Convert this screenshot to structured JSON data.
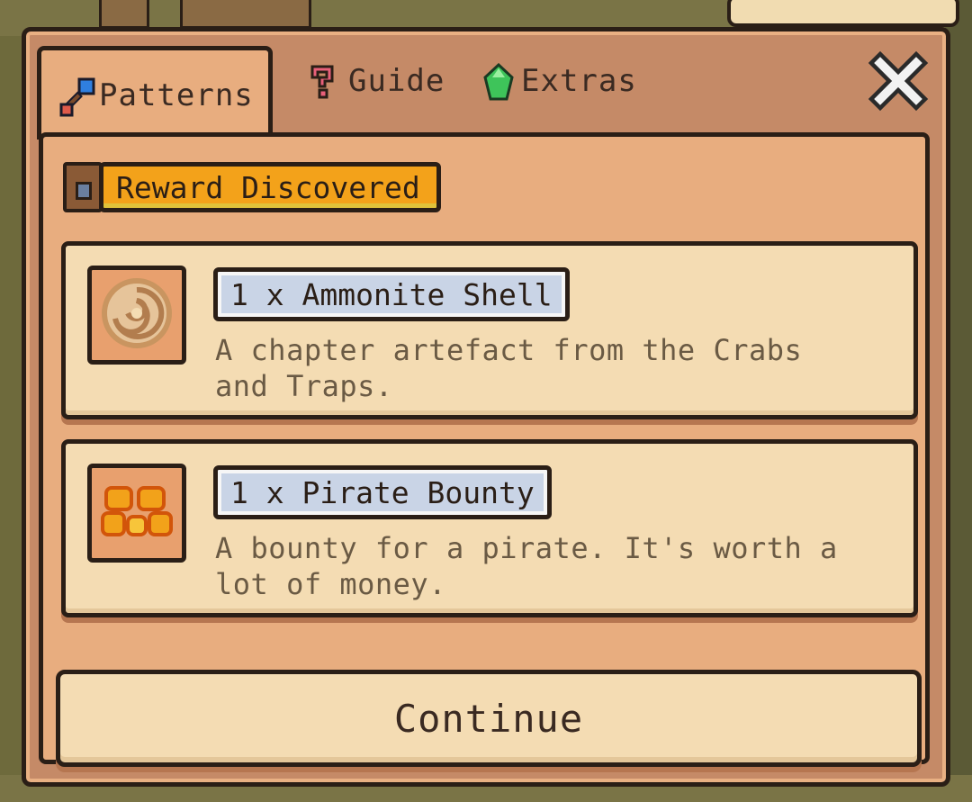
{
  "tabs": [
    {
      "label": "Patterns",
      "icon": "shovel-icon",
      "active": true
    },
    {
      "label": "Guide",
      "icon": "question-mark-icon",
      "active": false
    },
    {
      "label": "Extras",
      "icon": "green-gem-icon",
      "active": false
    }
  ],
  "badge": {
    "label": "Reward Discovered",
    "icon": "treasure-chest-icon"
  },
  "rewards": [
    {
      "name": "1 x Ammonite Shell",
      "description": "A chapter artefact from the Crabs and Traps.",
      "icon": "ammonite-shell-icon"
    },
    {
      "name": "1 x Pirate Bounty",
      "description": "A bounty for a pirate. It's worth a lot of money.",
      "icon": "gold-coins-icon"
    }
  ],
  "continue_label": "Continue",
  "colors": {
    "frame": "#c58a67",
    "panel": "#e8ad7f",
    "card": "#f4dcb3",
    "badge": "#f3a21a",
    "name_tag": "#c9d4e6",
    "outline": "#2a1e16"
  }
}
